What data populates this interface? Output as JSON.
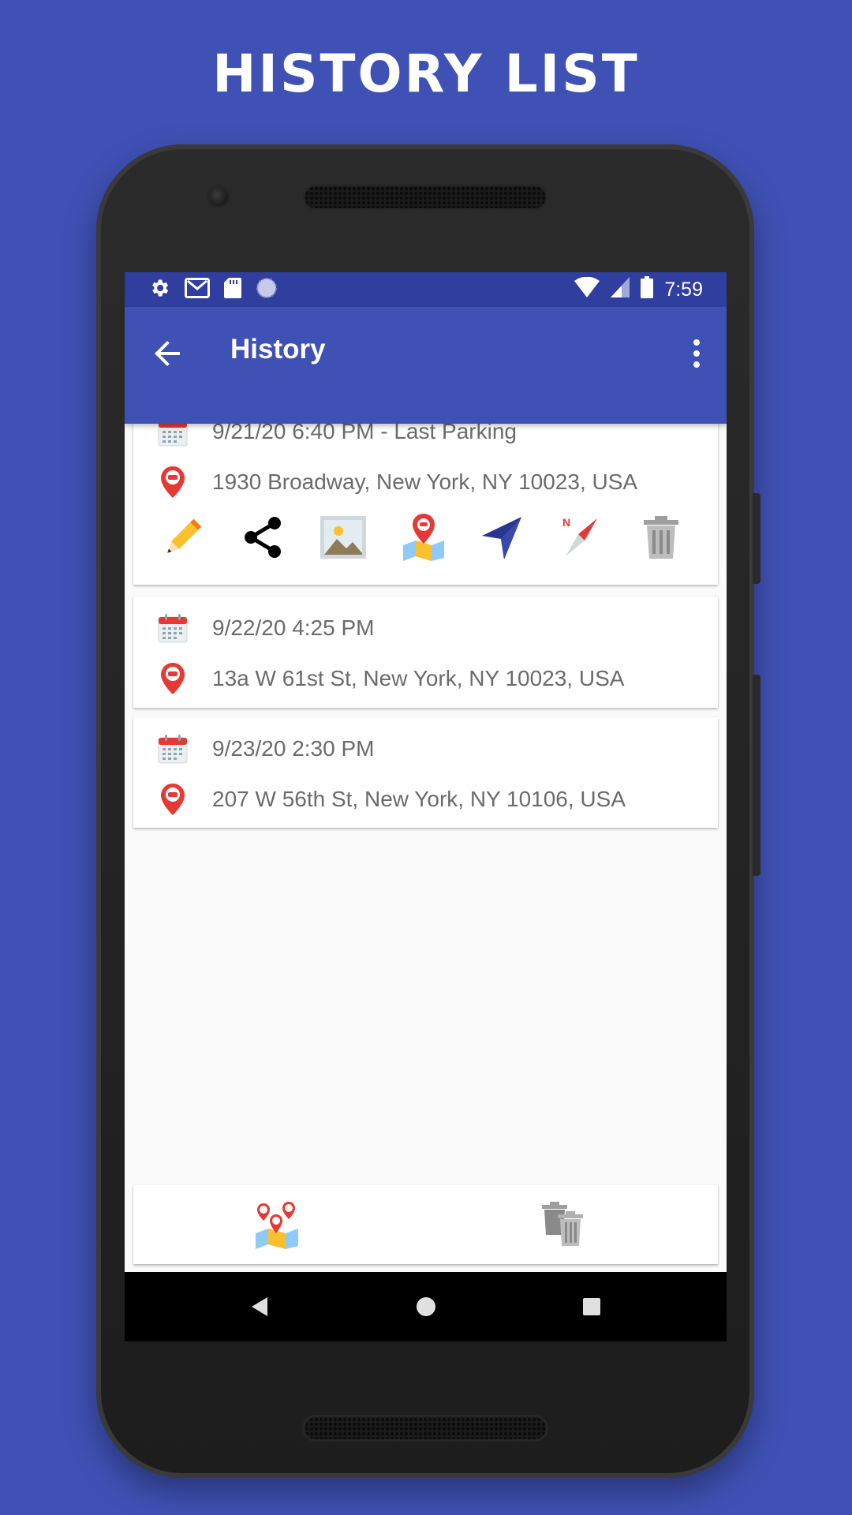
{
  "promo": {
    "headline": "HISTORY LIST"
  },
  "statusbar": {
    "time": "7:59"
  },
  "appbar": {
    "title": "History"
  },
  "history": [
    {
      "datetime": "9/21/20 6:40 PM - Last Parking",
      "address": "1930 Broadway, New York, NY 10023, USA"
    },
    {
      "datetime": "9/22/20 4:25 PM",
      "address": "13a W 61st St, New York, NY 10023, USA"
    },
    {
      "datetime": "9/23/20 2:30 PM",
      "address": "207 W 56th St, New York, NY 10106, USA"
    }
  ],
  "actions": [
    "edit",
    "share",
    "photo",
    "show-on-map",
    "navigate",
    "compass",
    "delete"
  ],
  "colors": {
    "primary": "#3f51b5",
    "primary_dark": "#303f9f",
    "marker_red": "#e53935",
    "text_gray": "#6b6b6b"
  }
}
